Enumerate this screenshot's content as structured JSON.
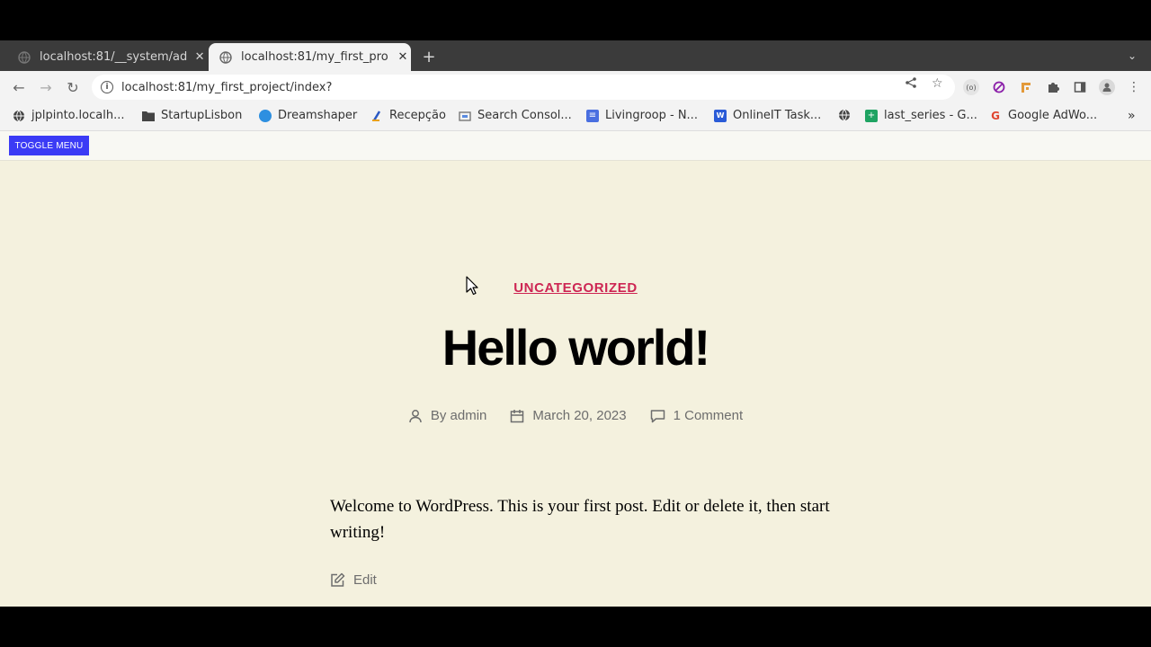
{
  "browser": {
    "tabs": [
      {
        "title": "localhost:81/__system/ad",
        "active": false
      },
      {
        "title": "localhost:81/my_first_pro",
        "active": true
      }
    ],
    "url": "localhost:81/my_first_project/index?",
    "bookmarks": [
      {
        "label": "jplpinto.localh...",
        "icon": "globe-icon"
      },
      {
        "label": "StartupLisbon",
        "icon": "folder-icon"
      },
      {
        "label": "Dreamshaper",
        "icon": "dreamshaper-icon"
      },
      {
        "label": "Recepção",
        "icon": "recepcao-icon"
      },
      {
        "label": "Search Consol...",
        "icon": "search-console-icon"
      },
      {
        "label": "Livingroop - N...",
        "icon": "doc-icon"
      },
      {
        "label": "OnlineIT Task...",
        "icon": "word-icon"
      },
      {
        "label": "",
        "icon": "globe-icon"
      },
      {
        "label": "last_series - G...",
        "icon": "sheets-icon"
      },
      {
        "label": "Google AdWo...",
        "icon": "google-icon"
      }
    ],
    "bookmarks_more": "»",
    "extension_label": "(o)"
  },
  "page": {
    "toggle_menu": "TOGGLE MENU",
    "category": "UNCATEGORIZED",
    "title": "Hello world!",
    "meta": {
      "author": "By admin",
      "date": "March 20, 2023",
      "comments": "1 Comment"
    },
    "body": "Welcome to WordPress. This is your first post. Edit or delete it, then start writing!",
    "edit_label": "Edit"
  },
  "colors": {
    "page_background": "#f4f1de",
    "accent": "#cd2653",
    "toggle_button": "#3b3bf5"
  }
}
